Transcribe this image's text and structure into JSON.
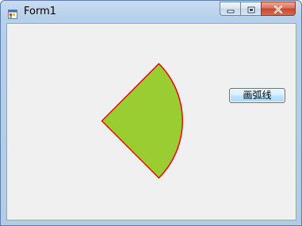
{
  "window": {
    "title": "Form1",
    "icons": {
      "app": "form-app-icon",
      "minimize": "minimize-icon",
      "maximize": "maximize-icon",
      "close": "close-icon"
    }
  },
  "canvas": {
    "shape": "pie-sector",
    "fill_color": "#9acd32",
    "stroke_color": "#ff0000"
  },
  "buttons": {
    "draw_arc_label": "画弧线"
  }
}
